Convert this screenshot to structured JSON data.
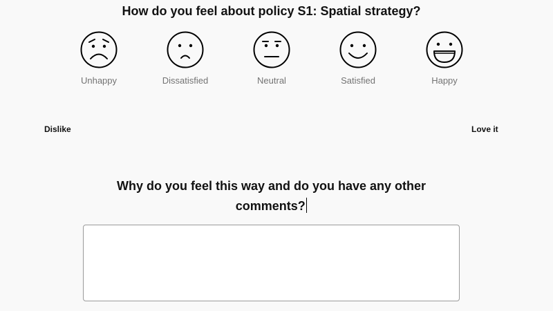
{
  "question": {
    "title": "How do you feel about policy S1: Spatial strategy?"
  },
  "faces": [
    {
      "label": "Unhappy",
      "icon": "unhappy-face-icon"
    },
    {
      "label": "Dissatisfied",
      "icon": "dissatisfied-face-icon"
    },
    {
      "label": "Neutral",
      "icon": "neutral-face-icon"
    },
    {
      "label": "Satisfied",
      "icon": "satisfied-face-icon"
    },
    {
      "label": "Happy",
      "icon": "happy-face-icon"
    }
  ],
  "scale": {
    "left_label": "Dislike",
    "right_label": "Love it"
  },
  "comments": {
    "question": "Why do you feel this way and do you have any other comments?",
    "value": "",
    "placeholder": ""
  }
}
